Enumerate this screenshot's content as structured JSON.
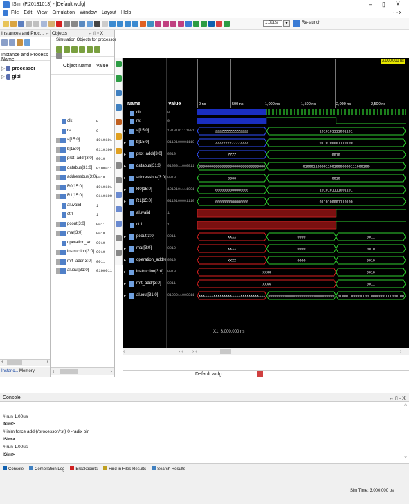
{
  "window": {
    "title": "ISim (P.20131013) - [Default.wcfg]",
    "min": "–",
    "max": "▯",
    "close": "X",
    "inner": "- ▫ x"
  },
  "menu": [
    "File",
    "Edit",
    "View",
    "Simulation",
    "Window",
    "Layout",
    "Help"
  ],
  "toolbar": {
    "time_value": "1.00us",
    "relaunch": "Re-launch"
  },
  "instances": {
    "header": "Instances and Proc...",
    "col": "Instance and Process Name",
    "items": [
      "processor",
      "glbl"
    ],
    "tab1": "Instanc...",
    "tab2": "Memory"
  },
  "objects": {
    "header": "Objects",
    "sub": "Simulation Objects for processor",
    "col_name": "Object Name",
    "col_value": "Value",
    "rows": [
      {
        "name": "clk",
        "value": "0"
      },
      {
        "name": "rst",
        "value": "0"
      },
      {
        "name": "a[15:0]",
        "value": "1010101"
      },
      {
        "name": "b[15:0]",
        "value": "0110100"
      },
      {
        "name": "prot_addr[3:0]",
        "value": "0010"
      },
      {
        "name": "databus[31:0]",
        "value": "0100011"
      },
      {
        "name": "addressbus[3:0]",
        "value": "0010"
      },
      {
        "name": "R0[15:0]",
        "value": "1010101"
      },
      {
        "name": "R1[15:0]",
        "value": "0110100"
      },
      {
        "name": "aluvalid",
        "value": "1"
      },
      {
        "name": "ctrl",
        "value": "1"
      },
      {
        "name": "pcout[3:0]",
        "value": "0011"
      },
      {
        "name": "mar[3:0]",
        "value": "0010"
      },
      {
        "name": "operation_ad...",
        "value": "0010"
      },
      {
        "name": "instruction[3:0]",
        "value": "0010"
      },
      {
        "name": "mrt_addr[3:0]",
        "value": "0011"
      },
      {
        "name": "aluout[31:0]",
        "value": "0100011"
      }
    ]
  },
  "wave": {
    "col_name": "Name",
    "col_value": "Value",
    "cursor_label": "3,000.000 ns",
    "ticks": [
      "0 ns",
      "500 ns",
      "1,000 ns",
      "1,500 ns",
      "2,000 ns",
      "2,500 ns"
    ],
    "signals": [
      {
        "name": "clk",
        "value": "0"
      },
      {
        "name": "rst",
        "value": "0"
      },
      {
        "name": "a[15:0]",
        "value": "1010101111001",
        "seg1": "ZZZZZZZZZZZZZZZZ",
        "seg2": "1010101111001101"
      },
      {
        "name": "b[15:0]",
        "value": "0110100001110",
        "seg1": "ZZZZZZZZZZZZZZZZ",
        "seg2": "0110100001110100"
      },
      {
        "name": "prot_addr[3:0]",
        "value": "0010",
        "seg1": "ZZZZ",
        "seg2": "0010"
      },
      {
        "name": "databus[31:0]",
        "value": "0100011000011",
        "seg1": "00000000000000000000000000000000",
        "seg2": "01000110000110010000000111000100"
      },
      {
        "name": "addressbus[3:0]",
        "value": "0010",
        "seg1": "0000",
        "seg2": "0010"
      },
      {
        "name": "R0[15:0]",
        "value": "1010101111001",
        "seg1": "0000000000000000",
        "seg2": "1010101111001101"
      },
      {
        "name": "R1[15:0]",
        "value": "0110100001110",
        "seg1": "0000000000000000",
        "seg2": "0110100001110100"
      },
      {
        "name": "aluvalid",
        "value": "1"
      },
      {
        "name": "ctrl",
        "value": "1"
      },
      {
        "name": "pcout[3:0]",
        "value": "0011",
        "seg1": "XXXX",
        "seg2": "0000",
        "seg3": "0011"
      },
      {
        "name": "mar[3:0]",
        "value": "0010",
        "seg1": "XXXX",
        "seg2": "0000",
        "seg3": "0010"
      },
      {
        "name": "operation_address",
        "value": "0010",
        "seg1": "XXXX",
        "seg2": "0000",
        "seg3": "0010"
      },
      {
        "name": "instruction[3:0]",
        "value": "0010",
        "seg1": "XXXX",
        "seg2": "0010"
      },
      {
        "name": "mrt_addr[3:0]",
        "value": "0011",
        "seg1": "XXXX",
        "seg2": "0011"
      },
      {
        "name": "aluout[31:0]",
        "value": "0100011000011",
        "seg1": "XXXXXXXXXXXXXXXXXXXXXXXXXXXXXXXX",
        "seg2": "00000000000000000000000000000000",
        "seg3": "01000110000110010000000111000100"
      }
    ],
    "cursor_readout": "X1: 3,000.000 ns",
    "tab": "Default.wcfg"
  },
  "console": {
    "title": "Console",
    "controls": "↔ ▯ ▫ X",
    "lines": [
      "# run 1.00us",
      "ISim>",
      "# isim force add {/processor/rst} 0 -radix bin",
      "ISim>",
      "# run 1.00us",
      "ISim>"
    ],
    "tabs": [
      "Console",
      "Compilation Log",
      "Breakpoints",
      "Find in Files Results",
      "Search Results"
    ]
  },
  "status": {
    "sim_time": "Sim Time: 3,000,000 ps"
  }
}
